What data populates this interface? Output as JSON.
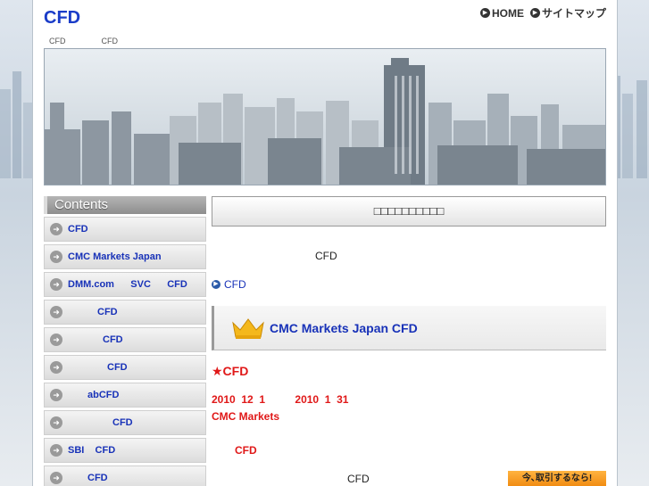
{
  "site": {
    "title": "CFD"
  },
  "top_nav": {
    "home": "HOME",
    "sitemap": "サイトマップ"
  },
  "breadcrumbs": [
    "CFD",
    "CFD"
  ],
  "sidebar": {
    "heading": "Contents",
    "items": [
      {
        "label": "CFD"
      },
      {
        "label": "CMC Markets Japan"
      },
      {
        "label": "DMM.com      SVC      CFD"
      },
      {
        "label": "CFD"
      },
      {
        "label": "CFD"
      },
      {
        "label": "CFD"
      },
      {
        "label": "abCFD"
      },
      {
        "label": "CFD"
      },
      {
        "label": "SBI    CFD"
      },
      {
        "label": "CFD"
      }
    ]
  },
  "main": {
    "heading": "□□□□□□□□□□",
    "intro": "CFD",
    "link": "CFD",
    "section_title": "CMC Markets Japan CFD",
    "star_heading": "★CFD",
    "red_lines": [
      "2010  12  1          2010  1  31",
      "CMC Markets",
      "CFD"
    ],
    "bottom_text": "CFD",
    "promo": "今､取引するなら!"
  },
  "colors": {
    "link_blue": "#1832b8",
    "accent_red": "#e01818",
    "promo_orange": "#f5a020"
  }
}
